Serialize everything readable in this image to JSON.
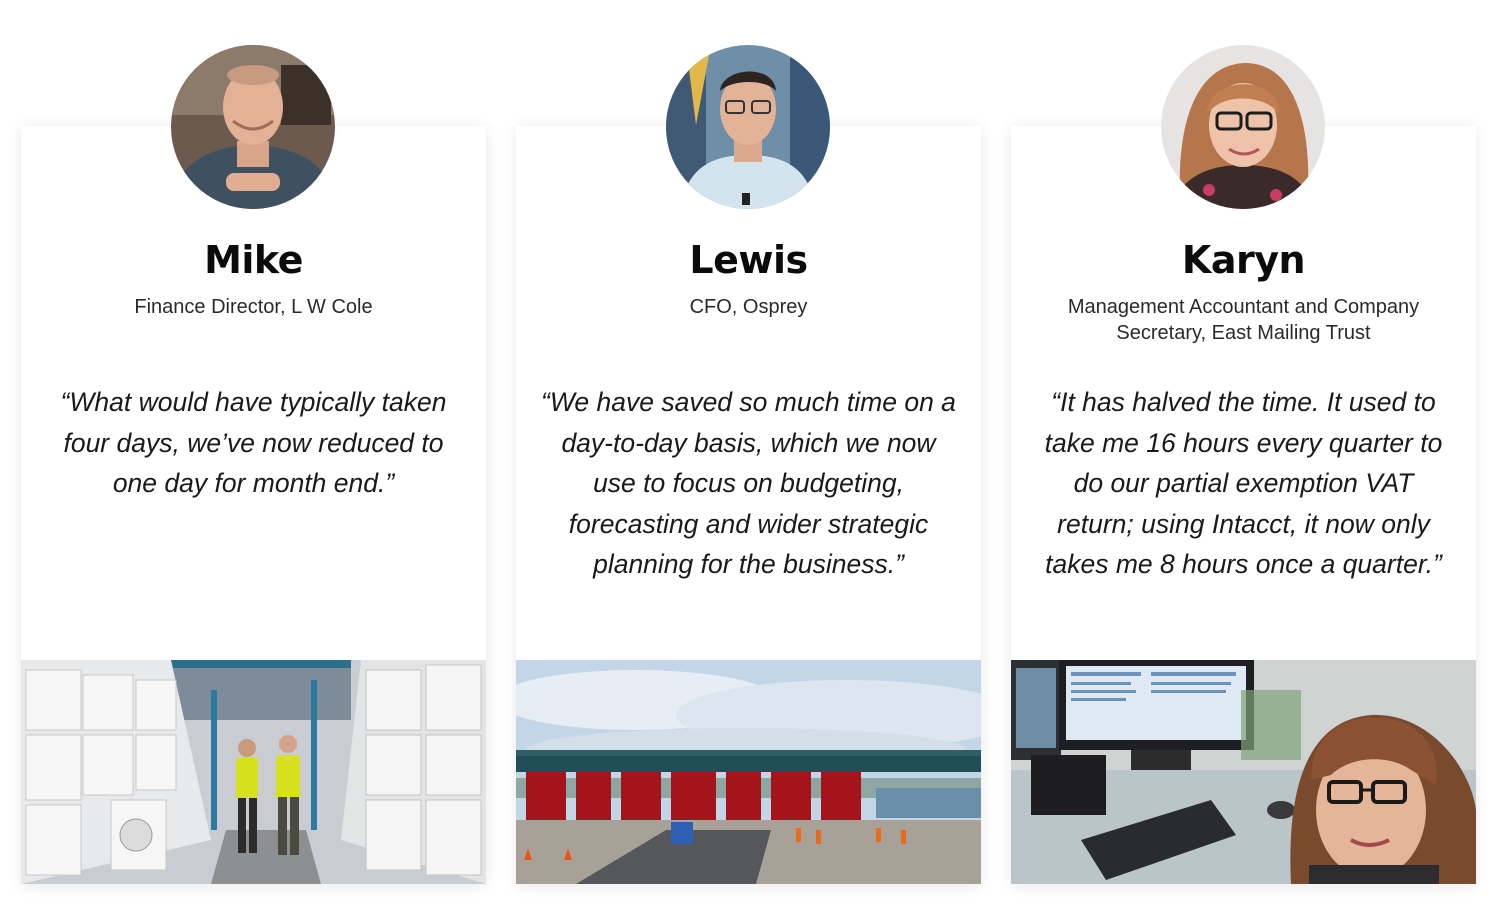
{
  "testimonials": [
    {
      "name": "Mike",
      "role": "Finance Director, L W Cole",
      "quote": "“What would have typically taken four days, we’ve now reduced to one day for month end.”"
    },
    {
      "name": "Lewis",
      "role": "CFO, Osprey",
      "quote": "“We have saved so much time on a day-to-day basis, which we now use to focus on budgeting, forecasting and wider strategic planning for the business.”"
    },
    {
      "name": "Karyn",
      "role": "Management Accountant and Company Secretary, East Mailing Trust",
      "quote": "“It has halved the time. It used to take me 16 hours every quarter to do our partial exemption VAT return; using Intacct, it now only takes me 8 hours once a quarter.”"
    }
  ],
  "colors": {
    "card_bg": "#ffffff",
    "text": "#111111",
    "hi_vis": "#d6e01c",
    "bridge_red": "#b0161c",
    "sky": "#bcd2e6"
  }
}
